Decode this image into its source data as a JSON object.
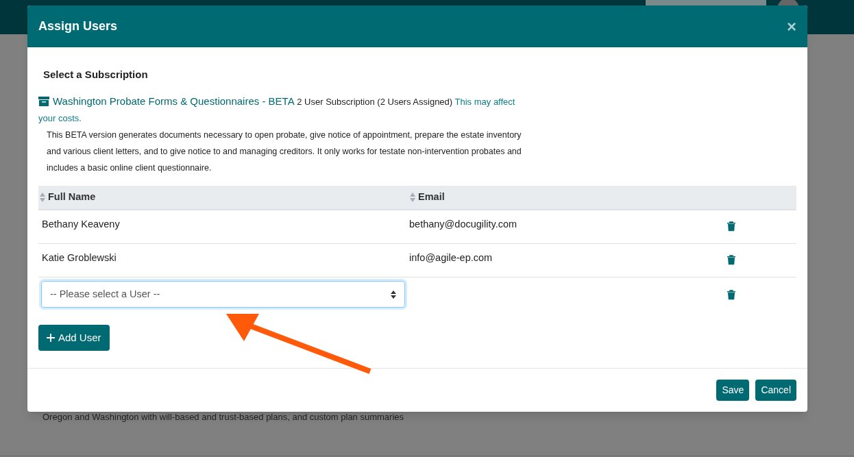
{
  "background": {
    "text": "Oregon and Washington with will-based and trust-based plans, and custom plan summaries"
  },
  "dialog": {
    "title": "Assign Users",
    "close": "×",
    "section_title": "Select a Subscription",
    "subscription": {
      "name": "Washington Probate Forms & Questionnaires - BETA",
      "info": "2 User Subscription (2 Users Assigned)",
      "warning": "This may affect your costs.",
      "description": "This BETA version generates documents necessary to open probate, give notice of appointment, prepare the estate inventory and various client letters, and to give notice to and managing creditors. It only works for testate non-intervention probates and includes a basic online client questionnaire."
    },
    "table": {
      "columns": [
        "Full Name",
        "Email"
      ],
      "rows": [
        {
          "name": "Bethany Keaveny",
          "email": "bethany@docugility.com"
        },
        {
          "name": "Katie Groblewski",
          "email": "info@agile-ep.com"
        }
      ],
      "new_row": {
        "placeholder": "-- Please select a User --"
      }
    },
    "add_button": "Add User",
    "buttons": [
      "Save",
      "Cancel"
    ]
  }
}
